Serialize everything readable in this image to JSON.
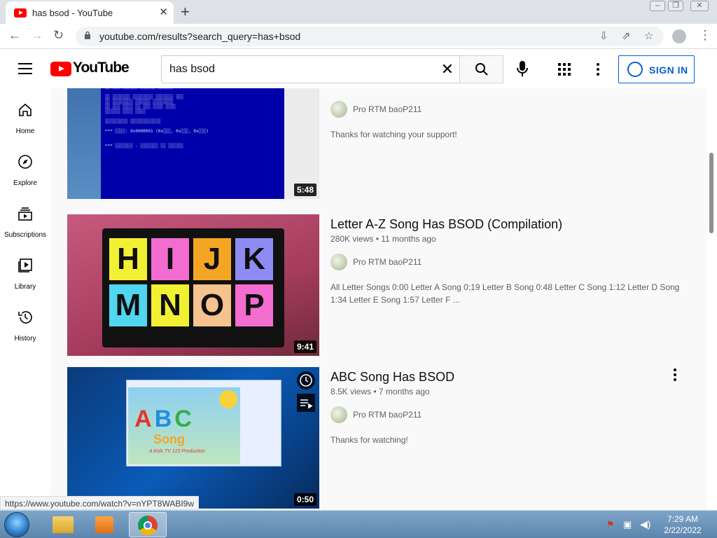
{
  "browser": {
    "tab_title": "has bsod - YouTube",
    "url": "youtube.com/results?search_query=has+bsod",
    "status_url": "https://www.youtube.com/watch?v=nYPT8WABI9w"
  },
  "header": {
    "logo_text": "YouTube",
    "search_value": "has bsod",
    "signin_label": "SIGN IN"
  },
  "guide": {
    "items": [
      {
        "label": "Home",
        "icon": "home-icon"
      },
      {
        "label": "Explore",
        "icon": "compass-icon"
      },
      {
        "label": "Subscriptions",
        "icon": "subscriptions-icon"
      },
      {
        "label": "Library",
        "icon": "library-icon"
      },
      {
        "label": "History",
        "icon": "history-icon"
      }
    ]
  },
  "results": [
    {
      "title": "",
      "meta": "",
      "channel": "Pro RTM baoP211",
      "description": "Thanks for watching your support!",
      "duration": "5:48"
    },
    {
      "title": "Letter A-Z Song Has BSOD (Compilation)",
      "meta": "280K views • 11 months ago",
      "channel": "Pro RTM baoP211",
      "description": "All Letter Songs 0:00 Letter A Song 0:19 Letter B Song 0:48 Letter C Song 1:12 Letter D Song 1:34 Letter E Song 1:57 Letter F ...",
      "duration": "9:41",
      "thumb_letters": [
        "H",
        "I",
        "J",
        "K",
        "M",
        "N",
        "O",
        "P"
      ]
    },
    {
      "title": "ABC Song Has BSOD",
      "meta": "8.5K views • 7 months ago",
      "channel": "Pro RTM baoP211",
      "description": "Thanks for watching!",
      "duration": "0:50",
      "thumb_text": [
        "A",
        "B",
        "C",
        "Song",
        "A Kids TV 123 Production"
      ]
    }
  ],
  "taskbar": {
    "time": "7:29 AM",
    "date": "2/22/2022"
  },
  "colors": {
    "brand_red": "#ff0000",
    "link_blue": "#065fd4",
    "bsod_blue": "#0000aa"
  }
}
